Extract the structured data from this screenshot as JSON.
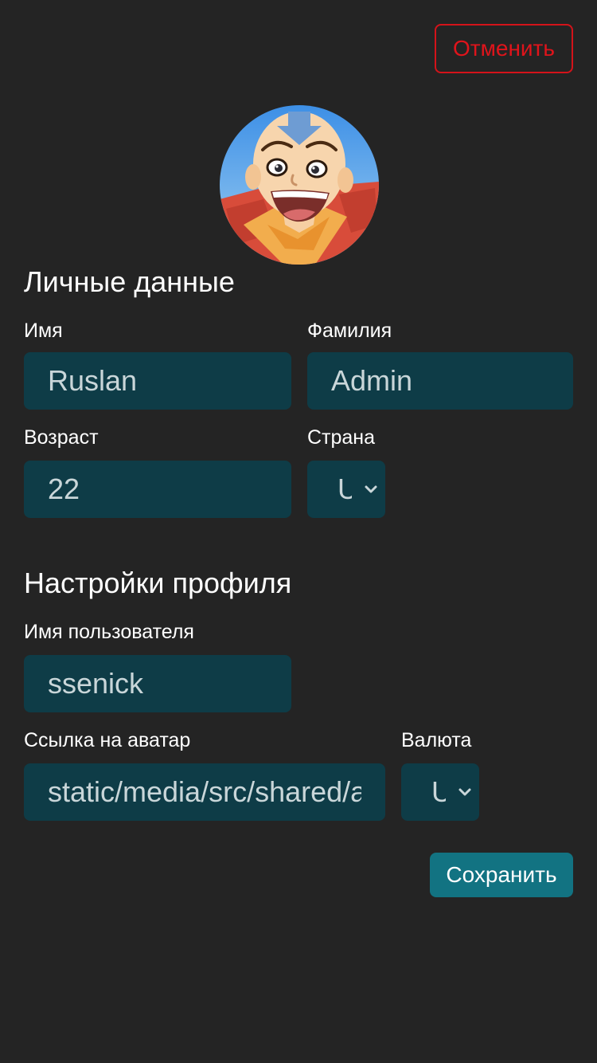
{
  "header": {
    "cancel_label": "Отменить"
  },
  "profile": {
    "avatar_icon": "avatar-image"
  },
  "personal": {
    "title": "Личные данные",
    "first_name_label": "Имя",
    "first_name_value": "Ruslan",
    "last_name_label": "Фамилия",
    "last_name_value": "Admin",
    "age_label": "Возраст",
    "age_value": "22",
    "country_label": "Страна",
    "country_value": "U"
  },
  "settings": {
    "title": "Настройки профиля",
    "username_label": "Имя пользователя",
    "username_value": "ssenick",
    "avatar_link_label": "Ссылка на аватар",
    "avatar_link_value": "static/media/src/shared/assets/avatar",
    "currency_label": "Валюта",
    "currency_value": "U"
  },
  "footer": {
    "save_label": "Сохранить"
  },
  "colors": {
    "background": "#242424",
    "input_bg": "#0e3c47",
    "cancel": "#e0141b",
    "save_bg": "#127382"
  }
}
